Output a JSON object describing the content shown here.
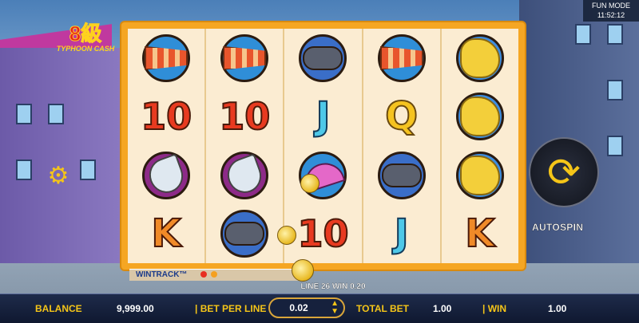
{
  "top_status": {
    "mode": "FUN MODE",
    "time": "11:52:12"
  },
  "logo": {
    "main_text": "8級",
    "sub_text": "TYPHOON CASH"
  },
  "reels": [
    [
      "windsock",
      "10",
      "dish",
      "K"
    ],
    [
      "windsock",
      "10",
      "dish",
      "storm-cloud"
    ],
    [
      "storm-cloud",
      "J",
      "umbrella",
      "10"
    ],
    [
      "windsock",
      "Q",
      "storm-cloud",
      "J"
    ],
    [
      "radar-map",
      "radar-map",
      "radar-map",
      "K"
    ]
  ],
  "controls": {
    "autospin_label": "AUTOSPIN"
  },
  "wintrack": {
    "label": "WINTRACK™"
  },
  "line_win": {
    "text": "LINE 26 WIN 0.20"
  },
  "bottom_bar": {
    "balance_label": "BALANCE",
    "balance_value": "9,999.00",
    "bet_per_line_label": "| BET PER LINE",
    "bet_per_line_value": "0.02",
    "total_bet_label": "TOTAL BET",
    "total_bet_value": "1.00",
    "win_label": "| WIN",
    "win_value": "1.00"
  },
  "colors": {
    "reel_frame": "#f5a623",
    "accent_gold": "#f5c518",
    "bottom_bar": "#1e2b4a"
  }
}
